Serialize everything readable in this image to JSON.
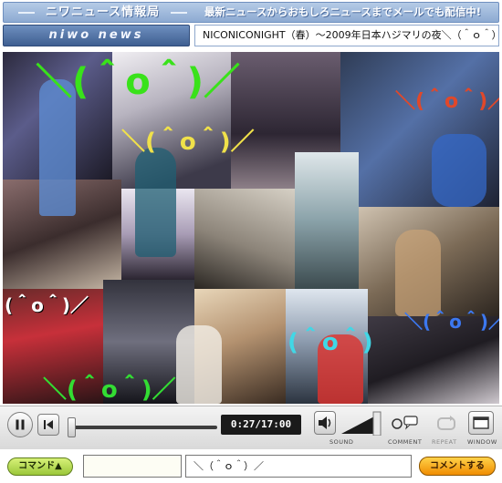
{
  "header": {
    "logo_top": "ニワニュース情報局",
    "tagline": "最新ニュースからおもしろニュースまでメールでも配信中!",
    "logo_bottom": "niwo news",
    "video_title": "NICONICONIGHT（春）～2009年日本ハジマリの夜＼（＾ｏ＾）／～"
  },
  "video": {
    "overlay_comments": [
      {
        "text": "＼(＾o＾)／",
        "color": "#39e21a"
      },
      {
        "text": "＼(＾o＾)／",
        "color": "#f0e14a"
      },
      {
        "text": "＼(＾o＾)／",
        "color": "#e0482a"
      },
      {
        "text": "(＾o＾)／",
        "color": "#ffffff"
      },
      {
        "text": "＼(＾o＾)／",
        "color": "#3c78f0"
      },
      {
        "text": "(＾o＾)",
        "color": "#41d7e6"
      },
      {
        "text": "＼(＾o＾)／",
        "color": "#33dd33"
      }
    ]
  },
  "controls": {
    "current_time": "0:27",
    "total_time": "17:00",
    "time_display": "0:27/17:00",
    "progress": 0.026,
    "sound_label": "SOUND",
    "comment_label": "COMMENT",
    "repeat_label": "REPEAT",
    "window_label": "WINDOW",
    "volume_level": 0.8
  },
  "comment_bar": {
    "command_label": "コマンド▲",
    "command_value": "",
    "comment_value": "＼（＾ｏ＾）／",
    "submit_label": "コメントする"
  }
}
